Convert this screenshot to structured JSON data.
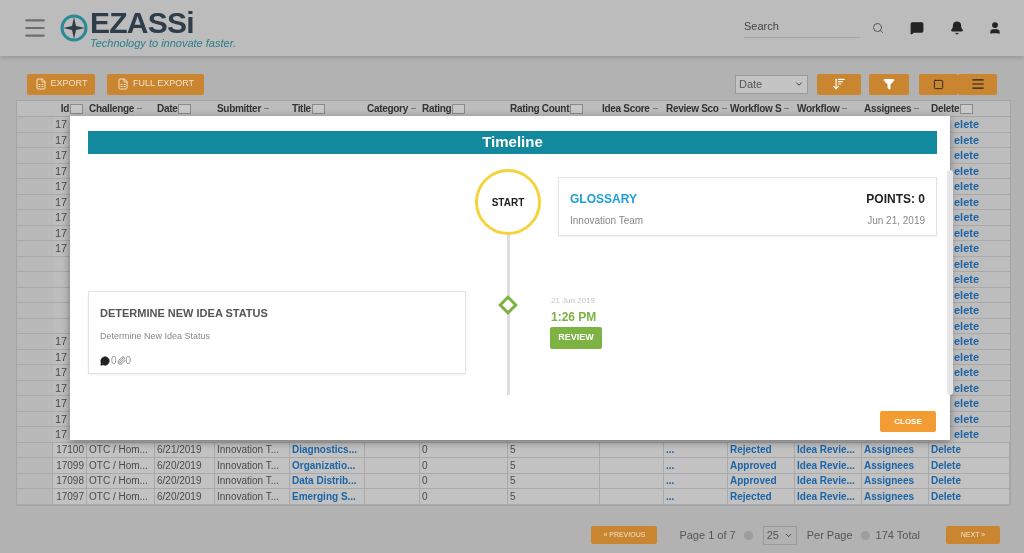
{
  "header": {
    "logo_text": "EZASSi",
    "tagline": "Technology to innovate faster.",
    "search": {
      "placeholder": "Search"
    }
  },
  "toolbar": {
    "buttons": [
      "EXPORT",
      "FULL EXPORT"
    ],
    "sort_select": "Date",
    "view_modes": [
      {
        "kind": "grid"
      },
      {
        "kind": "list"
      }
    ]
  },
  "table": {
    "columns": [
      {
        "label": "Id",
        "filter": true,
        "link": false
      },
      {
        "label": "Challenge",
        "filter": false,
        "link": false
      },
      {
        "label": "Date",
        "filter": true,
        "link": false
      },
      {
        "label": "Submitter",
        "filter": false,
        "link": false
      },
      {
        "label": "Title",
        "filter": true,
        "link": true
      },
      {
        "label": "Category",
        "filter": false
      },
      {
        "label": "Rating",
        "filter": true,
        "link": false
      },
      {
        "label": "Rating Count",
        "filter": true,
        "link": false
      },
      {
        "label": "Idea Score",
        "filter": false
      },
      {
        "label": "Review Sco",
        "filter": false,
        "link": true
      },
      {
        "label": "Workflow S",
        "filter": false,
        "link": true
      },
      {
        "label": "Workflow",
        "filter": false,
        "link": true
      },
      {
        "label": "Assignees",
        "filter": false,
        "link": true
      },
      {
        "label": "Delete",
        "filter": true,
        "link": true
      }
    ],
    "rows": [
      {
        "kind": "covered",
        "id": "17",
        "delete": "elete"
      },
      {
        "kind": "covered",
        "id": "17",
        "delete": "elete"
      },
      {
        "kind": "covered",
        "id": "17",
        "delete": "elete"
      },
      {
        "kind": "covered",
        "id": "17",
        "delete": "elete"
      },
      {
        "kind": "covered",
        "id": "17",
        "delete": "elete"
      },
      {
        "kind": "covered",
        "id": "17",
        "delete": "elete"
      },
      {
        "kind": "covered",
        "id": "17",
        "delete": "elete"
      },
      {
        "kind": "covered",
        "id": "17",
        "delete": "elete"
      },
      {
        "kind": "covered",
        "id": "17",
        "delete": "elete"
      },
      {
        "kind": "covered",
        "delete": "elete"
      },
      {
        "kind": "covered",
        "delete": "elete"
      },
      {
        "kind": "covered",
        "delete": "elete"
      },
      {
        "kind": "covered",
        "delete": "elete"
      },
      {
        "kind": "covered",
        "delete": "elete"
      },
      {
        "kind": "covered",
        "id": "17",
        "delete": "elete"
      },
      {
        "kind": "covered",
        "id": "17",
        "delete": "elete"
      },
      {
        "kind": "covered",
        "id": "17",
        "delete": "elete"
      },
      {
        "kind": "covered",
        "id": "17",
        "delete": "elete"
      },
      {
        "kind": "covered",
        "id": "17",
        "delete": "elete"
      },
      {
        "kind": "covered",
        "id": "17",
        "delete": "elete"
      },
      {
        "kind": "covered",
        "id": "17",
        "delete": "elete"
      },
      {
        "kind": "full",
        "cells": [
          "17100",
          "OTC / Hom...",
          "6/21/2019",
          "Innovation T...",
          "Diagnostics...",
          null,
          "0",
          "5",
          null,
          "...",
          "Rejected",
          "Idea Revie...",
          "Assignees",
          "Delete"
        ]
      },
      {
        "kind": "full",
        "cells": [
          "17099",
          "OTC / Hom...",
          "6/20/2019",
          "Innovation T...",
          "Organizatio...",
          null,
          "0",
          "5",
          null,
          "...",
          "Approved",
          "Idea Revie...",
          "Assignees",
          "Delete"
        ]
      },
      {
        "kind": "full",
        "cells": [
          "17098",
          "OTC / Hom...",
          "6/20/2019",
          "Innovation T...",
          "Data Distrib...",
          null,
          "0",
          "5",
          null,
          "...",
          "Approved",
          "Idea Revie...",
          "Assignees",
          "Delete"
        ]
      },
      {
        "kind": "full",
        "cells": [
          "17097",
          "OTC / Hom...",
          "6/20/2019",
          "Innovation T...",
          "Emerging S...",
          null,
          "0",
          "5",
          null,
          "...",
          "Rejected",
          "Idea Revie...",
          "Assignees",
          "Delete"
        ]
      }
    ]
  },
  "modal": {
    "title": "Timeline",
    "start_label": "START",
    "glossary": {
      "title": "GLOSSARY",
      "points": "POINTS: 0",
      "team": "Innovation Team",
      "date": "Jun 21, 2019"
    },
    "events": [
      {
        "title": "DETERMINE NEW IDEA STATUS",
        "description": "Determine New Idea Status",
        "comments": "0",
        "attachments": "0",
        "date": "21 Jun 2019",
        "time": "1:26 PM",
        "badge": "REVIEW"
      }
    ],
    "close": "CLOSE"
  },
  "footer": {
    "previous": "« PREVIOUS",
    "page_info": "Page 1 of 7",
    "per_page_value": "25",
    "per_page_label": "Per Page",
    "total": "174 Total",
    "next": "NEXT »"
  }
}
